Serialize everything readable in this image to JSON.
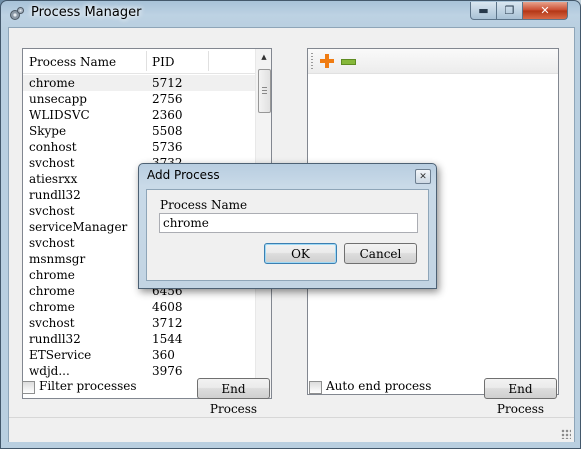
{
  "window": {
    "title": "Process Manager",
    "controls": {
      "minimize": "▬",
      "maximize": "❐",
      "close": "✕"
    }
  },
  "process_list": {
    "columns": [
      "Process Name",
      "PID"
    ],
    "rows": [
      {
        "name": "chrome",
        "pid": "5712"
      },
      {
        "name": "unsecapp",
        "pid": "2756"
      },
      {
        "name": "WLIDSVC",
        "pid": "2360"
      },
      {
        "name": "Skype",
        "pid": "5508"
      },
      {
        "name": "conhost",
        "pid": "5736"
      },
      {
        "name": "svchost",
        "pid": "3732"
      },
      {
        "name": "atiesrxx",
        "pid": ""
      },
      {
        "name": "rundll32",
        "pid": ""
      },
      {
        "name": "svchost",
        "pid": ""
      },
      {
        "name": "serviceManager",
        "pid": ""
      },
      {
        "name": "svchost",
        "pid": ""
      },
      {
        "name": "msnmsgr",
        "pid": ""
      },
      {
        "name": "chrome",
        "pid": ""
      },
      {
        "name": "chrome",
        "pid": "6456"
      },
      {
        "name": "chrome",
        "pid": "4608"
      },
      {
        "name": "svchost",
        "pid": "3712"
      },
      {
        "name": "rundll32",
        "pid": "1544"
      },
      {
        "name": "ETService",
        "pid": "360"
      },
      {
        "name": "wdjd...",
        "pid": "3976"
      }
    ]
  },
  "left_controls": {
    "filter_label": "Filter processes",
    "end_process_label": "End Process"
  },
  "right_controls": {
    "auto_end_label": "Auto end process",
    "end_process_label": "End Process"
  },
  "dialog": {
    "title": "Add Process",
    "close": "✕",
    "field_label": "Process Name",
    "field_value": "chrome",
    "ok_label": "OK",
    "cancel_label": "Cancel"
  }
}
